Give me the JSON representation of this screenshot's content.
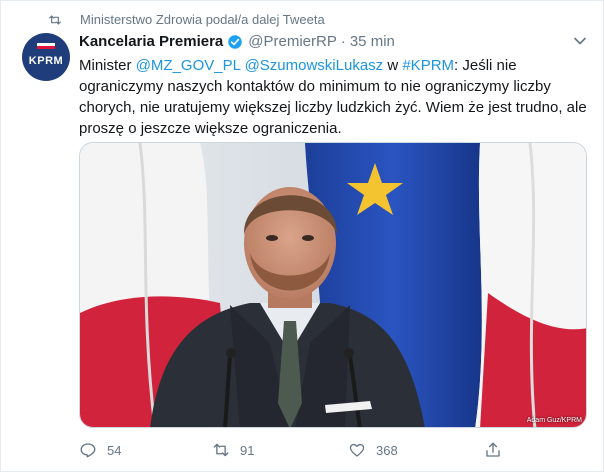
{
  "retweet_context": {
    "text": "Ministerstwo Zdrowia podał/a dalej Tweeta",
    "icon": "retweet-icon"
  },
  "tweet": {
    "avatar_text": "KPRM",
    "display_name": "Kancelaria Premiera",
    "verified": true,
    "handle": "@PremierRP",
    "separator": "·",
    "time": "35 min",
    "text_parts": {
      "t1": "Minister ",
      "mention1": "@MZ_GOV_PL",
      "t2": " ",
      "mention2": "@SzumowskiLukasz",
      "t3": " w ",
      "hashtag": "#KPRM",
      "t4": ": Jeśli nie ograniczymy naszych kontaktów do minimum to nie ograniczymy liczby chorych, nie uratujemy większej liczby ludzkich żyć. Wiem że jest trudno, ale proszę o jeszcze większe ograniczenia."
    },
    "photo_credit": "Adam Guz/KPRM"
  },
  "actions": {
    "reply_count": "54",
    "retweet_count": "91",
    "like_count": "368"
  },
  "colors": {
    "link": "#1b95e0",
    "muted": "#657786",
    "verified": "#1da1f2"
  }
}
